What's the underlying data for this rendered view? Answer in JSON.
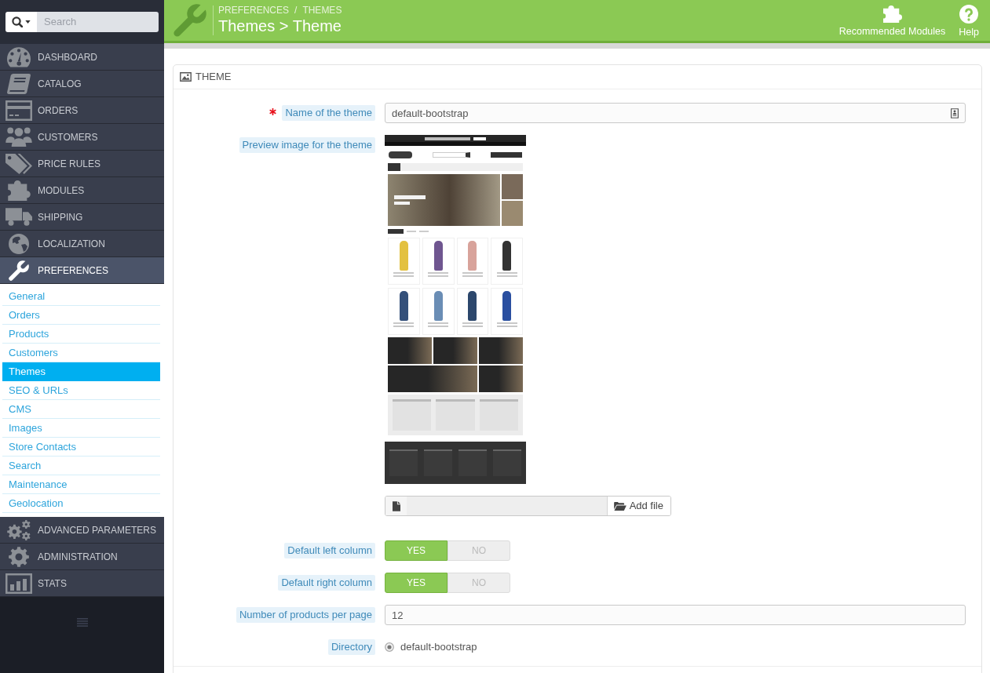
{
  "sidebar": {
    "search": {
      "placeholder": "Search"
    },
    "menu": [
      {
        "label": "DASHBOARD",
        "selected": false
      },
      {
        "label": "CATALOG",
        "selected": false
      },
      {
        "label": "ORDERS",
        "selected": false
      },
      {
        "label": "CUSTOMERS",
        "selected": false
      },
      {
        "label": "PRICE RULES",
        "selected": false
      },
      {
        "label": "MODULES",
        "selected": false
      },
      {
        "label": "SHIPPING",
        "selected": false
      },
      {
        "label": "LOCALIZATION",
        "selected": false
      },
      {
        "label": "PREFERENCES",
        "selected": true,
        "children": [
          {
            "label": "General",
            "selected": false
          },
          {
            "label": "Orders",
            "selected": false
          },
          {
            "label": "Products",
            "selected": false
          },
          {
            "label": "Customers",
            "selected": false
          },
          {
            "label": "Themes",
            "selected": true
          },
          {
            "label": "SEO & URLs",
            "selected": false
          },
          {
            "label": "CMS",
            "selected": false
          },
          {
            "label": "Images",
            "selected": false
          },
          {
            "label": "Store Contacts",
            "selected": false
          },
          {
            "label": "Search",
            "selected": false
          },
          {
            "label": "Maintenance",
            "selected": false
          },
          {
            "label": "Geolocation",
            "selected": false
          }
        ]
      },
      {
        "label": "ADVANCED PARAMETERS",
        "selected": false
      },
      {
        "label": "ADMINISTRATION",
        "selected": false
      },
      {
        "label": "STATS",
        "selected": false
      }
    ]
  },
  "header": {
    "breadcrumb": {
      "items": [
        "PREFERENCES",
        "THEMES"
      ],
      "separator": "/"
    },
    "title": "Themes > Theme",
    "toolbar": [
      {
        "label": "Recommended Modules"
      },
      {
        "label": "Help"
      }
    ]
  },
  "panel": {
    "title": "THEME",
    "fields": [
      {
        "kind": "icontext",
        "label": "Name of the theme",
        "required": true,
        "value": "default-bootstrap"
      },
      {
        "kind": "image",
        "label": "Preview image for the theme",
        "required": false
      },
      {
        "kind": "file",
        "button": "Add file"
      },
      {
        "kind": "switch",
        "label": "Default left column",
        "required": false,
        "options": [
          {
            "label": "YES",
            "selected": true
          },
          {
            "label": "NO",
            "selected": false
          }
        ]
      },
      {
        "kind": "switch",
        "label": "Default right column",
        "required": false,
        "options": [
          {
            "label": "YES",
            "selected": true
          },
          {
            "label": "NO",
            "selected": false
          }
        ]
      },
      {
        "kind": "text",
        "label": "Number of products per page",
        "required": false,
        "value": "12"
      },
      {
        "kind": "radio",
        "label": "Directory",
        "required": false,
        "options": [
          {
            "label": "default-bootstrap",
            "selected": true
          }
        ]
      }
    ]
  }
}
